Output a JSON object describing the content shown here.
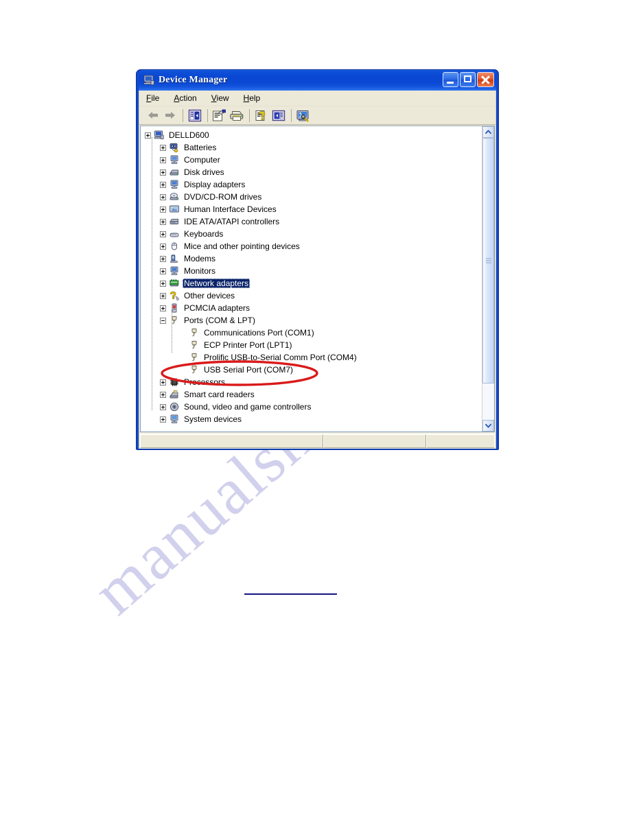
{
  "window": {
    "title": "Device Manager",
    "title_icon": "device-manager-icon",
    "buttons": {
      "minimize": "Minimize",
      "maximize": "Maximize",
      "close": "Close"
    }
  },
  "menubar": {
    "items": [
      {
        "label": "File",
        "accesskey": "F"
      },
      {
        "label": "Action",
        "accesskey": "A"
      },
      {
        "label": "View",
        "accesskey": "V"
      },
      {
        "label": "Help",
        "accesskey": "H"
      }
    ]
  },
  "toolbar": {
    "items": [
      {
        "name": "back-arrow-icon",
        "label": "Back",
        "enabled": false
      },
      {
        "name": "forward-arrow-icon",
        "label": "Forward",
        "enabled": false
      },
      {
        "name": "show-hide-console-tree-icon",
        "label": "Show/Hide Console Tree",
        "enabled": true
      },
      {
        "name": "properties-icon",
        "label": "Properties",
        "enabled": true
      },
      {
        "name": "print-icon",
        "label": "Print",
        "enabled": true
      },
      {
        "name": "help-icon",
        "label": "Help",
        "enabled": true
      },
      {
        "name": "update-driver-icon",
        "label": "Update Driver",
        "enabled": true
      },
      {
        "name": "scan-for-hardware-changes-icon",
        "label": "Scan for hardware changes",
        "enabled": true
      }
    ]
  },
  "tree": {
    "nodes": [
      {
        "label": "DELLD600",
        "level": 0,
        "state": "expanded",
        "icon": "computer-icon",
        "selected": false
      },
      {
        "label": "Batteries",
        "level": 1,
        "state": "collapsed",
        "icon": "battery-icon",
        "selected": false
      },
      {
        "label": "Computer",
        "level": 1,
        "state": "collapsed",
        "icon": "computer-node-icon",
        "selected": false
      },
      {
        "label": "Disk drives",
        "level": 1,
        "state": "collapsed",
        "icon": "disk-drive-icon",
        "selected": false
      },
      {
        "label": "Display adapters",
        "level": 1,
        "state": "collapsed",
        "icon": "display-adapter-icon",
        "selected": false
      },
      {
        "label": "DVD/CD-ROM drives",
        "level": 1,
        "state": "collapsed",
        "icon": "dvd-drive-icon",
        "selected": false
      },
      {
        "label": "Human Interface Devices",
        "level": 1,
        "state": "collapsed",
        "icon": "hid-icon",
        "selected": false
      },
      {
        "label": "IDE ATA/ATAPI controllers",
        "level": 1,
        "state": "collapsed",
        "icon": "ide-controller-icon",
        "selected": false
      },
      {
        "label": "Keyboards",
        "level": 1,
        "state": "collapsed",
        "icon": "keyboard-icon",
        "selected": false
      },
      {
        "label": "Mice and other pointing devices",
        "level": 1,
        "state": "collapsed",
        "icon": "mouse-icon",
        "selected": false
      },
      {
        "label": "Modems",
        "level": 1,
        "state": "collapsed",
        "icon": "modem-icon",
        "selected": false
      },
      {
        "label": "Monitors",
        "level": 1,
        "state": "collapsed",
        "icon": "monitor-icon",
        "selected": false
      },
      {
        "label": "Network adapters",
        "level": 1,
        "state": "collapsed",
        "icon": "network-adapter-icon",
        "selected": true
      },
      {
        "label": "Other devices",
        "level": 1,
        "state": "collapsed",
        "icon": "other-device-icon",
        "selected": false
      },
      {
        "label": "PCMCIA adapters",
        "level": 1,
        "state": "collapsed",
        "icon": "pcmcia-icon",
        "selected": false
      },
      {
        "label": "Ports (COM & LPT)",
        "level": 1,
        "state": "expanded",
        "icon": "port-icon",
        "selected": false
      },
      {
        "label": "Communications Port (COM1)",
        "level": 2,
        "state": "leaf",
        "icon": "port-icon",
        "selected": false
      },
      {
        "label": "ECP Printer Port (LPT1)",
        "level": 2,
        "state": "leaf",
        "icon": "port-icon",
        "selected": false
      },
      {
        "label": "Prolific USB-to-Serial Comm Port (COM4)",
        "level": 2,
        "state": "leaf",
        "icon": "port-icon",
        "selected": false
      },
      {
        "label": "USB Serial Port (COM7)",
        "level": 2,
        "state": "leaf",
        "icon": "port-icon",
        "selected": false,
        "highlighted": true
      },
      {
        "label": "Processors",
        "level": 1,
        "state": "collapsed",
        "icon": "processor-icon",
        "selected": false
      },
      {
        "label": "Smart card readers",
        "level": 1,
        "state": "collapsed",
        "icon": "smartcard-reader-icon",
        "selected": false
      },
      {
        "label": "Sound, video and game controllers",
        "level": 1,
        "state": "collapsed",
        "icon": "sound-controller-icon",
        "selected": false
      },
      {
        "label": "System devices",
        "level": 1,
        "state": "collapsed",
        "icon": "system-device-icon",
        "selected": false
      }
    ]
  },
  "scrollbar": {
    "up_arrow": "scroll-up-arrow-icon",
    "down_arrow": "scroll-down-arrow-icon",
    "thumb_position_percent": 0,
    "thumb_size_percent": 87
  },
  "statusbar": {
    "pane1": "",
    "pane2": "",
    "pane3": ""
  },
  "annotation": {
    "shape": "ellipse",
    "color": "#d91a1a",
    "targets": "USB Serial Port (COM7)"
  },
  "watermark": {
    "text": "manualshive.com",
    "color": "#c9c9ea"
  },
  "colors": {
    "title_bar_blue": "#0a47d2",
    "window_frame_blue": "#1449c8",
    "selection_blue": "#0a246a",
    "client_beige": "#ece9d8",
    "annotation_red": "#d91a1a",
    "rule_navy": "#141480"
  }
}
